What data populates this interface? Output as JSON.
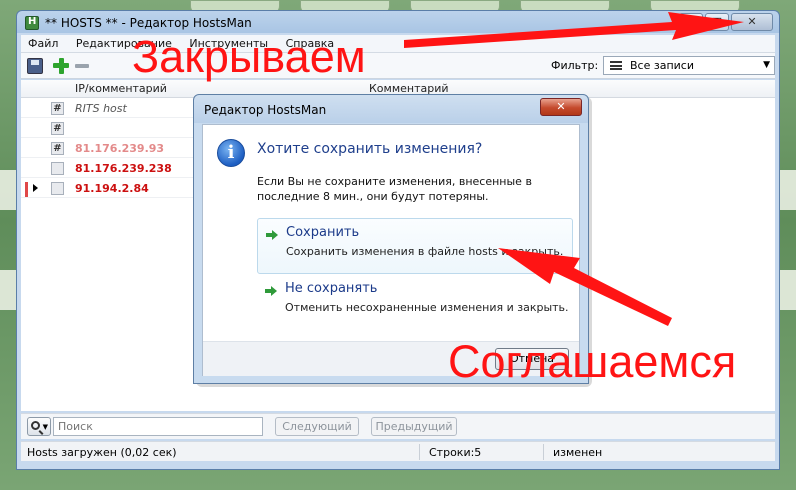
{
  "window": {
    "title": "** HOSTS ** - Редактор HostsMan",
    "close_glyph": "✕",
    "max_glyph": "□",
    "min_glyph": "–"
  },
  "menu": [
    {
      "label": "Файл"
    },
    {
      "label": "Редактирование"
    },
    {
      "label": "Инструменты"
    },
    {
      "label": "Справка"
    }
  ],
  "toolbar": {
    "filter_label": "Фильтр:",
    "filter_value": "Все записи",
    "filter_arrow": "▼"
  },
  "grid": {
    "headers": {
      "ip": "IP/комментарий",
      "comment": "Комментарий"
    },
    "rows": [
      {
        "box": "#",
        "text": "RITS host",
        "style": "comment"
      },
      {
        "box": "#",
        "text": "",
        "style": "comment"
      },
      {
        "box": "#",
        "text": "81.176.239.93",
        "style": "faded"
      },
      {
        "box": "",
        "text": "81.176.239.238",
        "style": "red"
      },
      {
        "box": "",
        "text": "91.194.2.84",
        "style": "red",
        "current": true
      }
    ]
  },
  "search": {
    "placeholder": "Поиск",
    "next_label": "Следующий",
    "prev_label": "Предыдущий"
  },
  "status": {
    "loaded": "Hosts загружен (0,02 сек)",
    "rows": "Строки:5",
    "state": "изменен"
  },
  "dialog": {
    "title": "Редактор HostsMan",
    "close_glyph": "✕",
    "info_glyph": "i",
    "heading": "Хотите сохранить изменения?",
    "message": "Если Вы не сохраните изменения, внесенные в последние 8 мин., они будут потеряны.",
    "save_title": "Сохранить",
    "save_desc": "Сохранить изменения в файле hosts и закрыть.",
    "nosave_title": "Не сохранять",
    "nosave_desc": "Отменить несохраненные изменения и закрыть.",
    "cancel_label": "Отмена"
  },
  "annotations": {
    "close": "Закрываем",
    "agree": "Соглашаемся",
    "color": "#ff1414"
  }
}
